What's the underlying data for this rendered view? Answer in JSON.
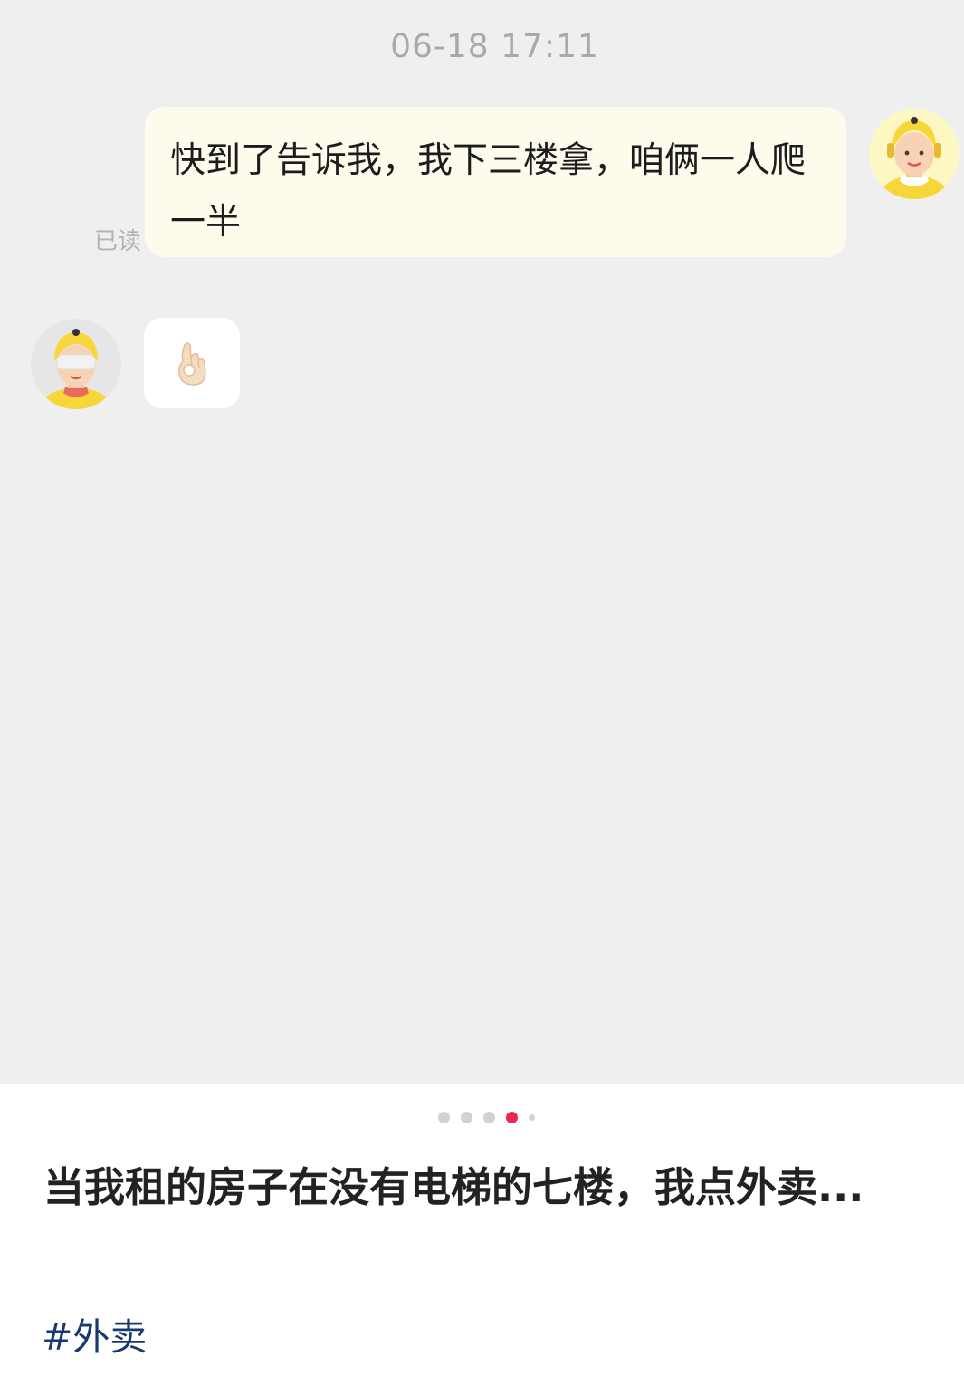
{
  "chat": {
    "timestamp": "06-18 17:11",
    "messages": [
      {
        "sender": "me",
        "text": "快到了告诉我，我下三楼拿，咱俩一人爬一半",
        "read_status": "已读",
        "avatar_icon": "courier-avatar-icon"
      },
      {
        "sender": "rider",
        "content_icon": "ok-hand-emoji-icon",
        "avatar_icon": "courier-avatar-icon"
      }
    ]
  },
  "pager": {
    "total_dots": 5,
    "active_index": 4
  },
  "post": {
    "title": "当我租的房子在没有电梯的七楼，我点外卖...",
    "tag": "#外卖"
  },
  "colors": {
    "chat_background": "#efefef",
    "outgoing_bubble": "#fdfbec",
    "incoming_bubble": "#ffffff",
    "pager_active": "#e8294a",
    "pager_inactive": "#d2d2d2",
    "tag_text": "#19386e",
    "avatar_yellow": "#f7d63a"
  }
}
